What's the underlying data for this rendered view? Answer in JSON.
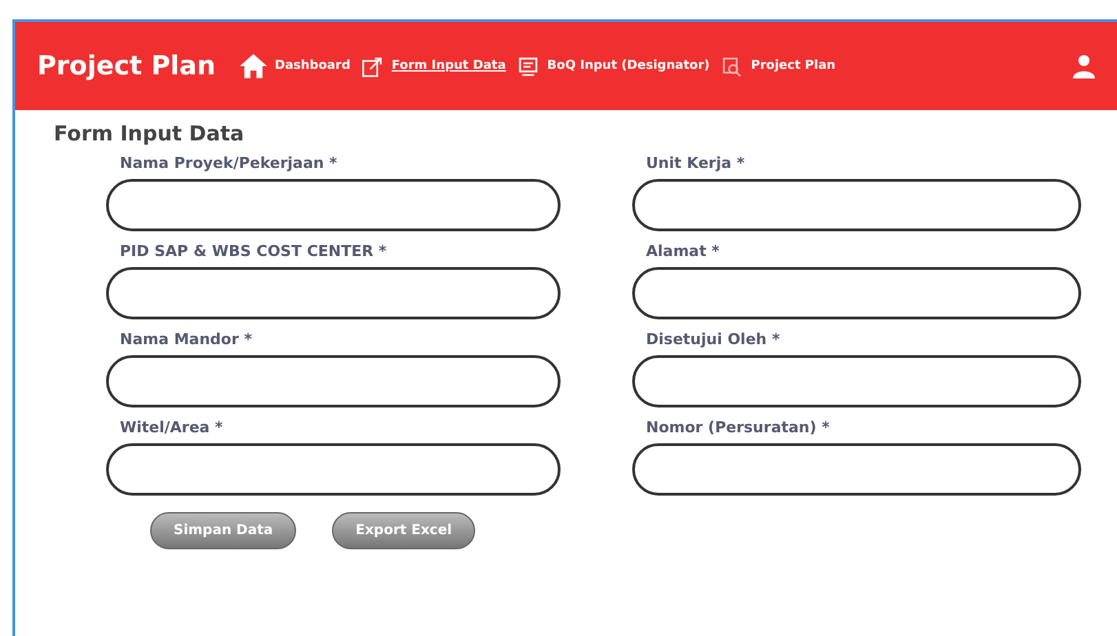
{
  "navbar": {
    "brand": "Project Plan",
    "items": [
      {
        "label": "Dashboard",
        "kind": "home",
        "selected": false
      },
      {
        "label": "Form Input Data",
        "kind": "edit",
        "selected": true
      },
      {
        "label": "BoQ Input (Designator)",
        "kind": "monitor",
        "selected": false
      },
      {
        "label": "Project Plan",
        "kind": "search",
        "selected": false
      }
    ]
  },
  "form": {
    "title": "Form Input Data",
    "fields": [
      {
        "label": "Nama Proyek/Pekerjaan *"
      },
      {
        "label": "Unit Kerja *"
      },
      {
        "label": "PID SAP & WBS COST CENTER *"
      },
      {
        "label": "Alamat *"
      },
      {
        "label": "Nama Mandor *"
      },
      {
        "label": "Disetujui Oleh *"
      },
      {
        "label": "Witel/Area *"
      },
      {
        "label": "Nomor (Persuratan) *"
      }
    ],
    "buttons": [
      "Simpan Data",
      "Export Excel"
    ]
  }
}
